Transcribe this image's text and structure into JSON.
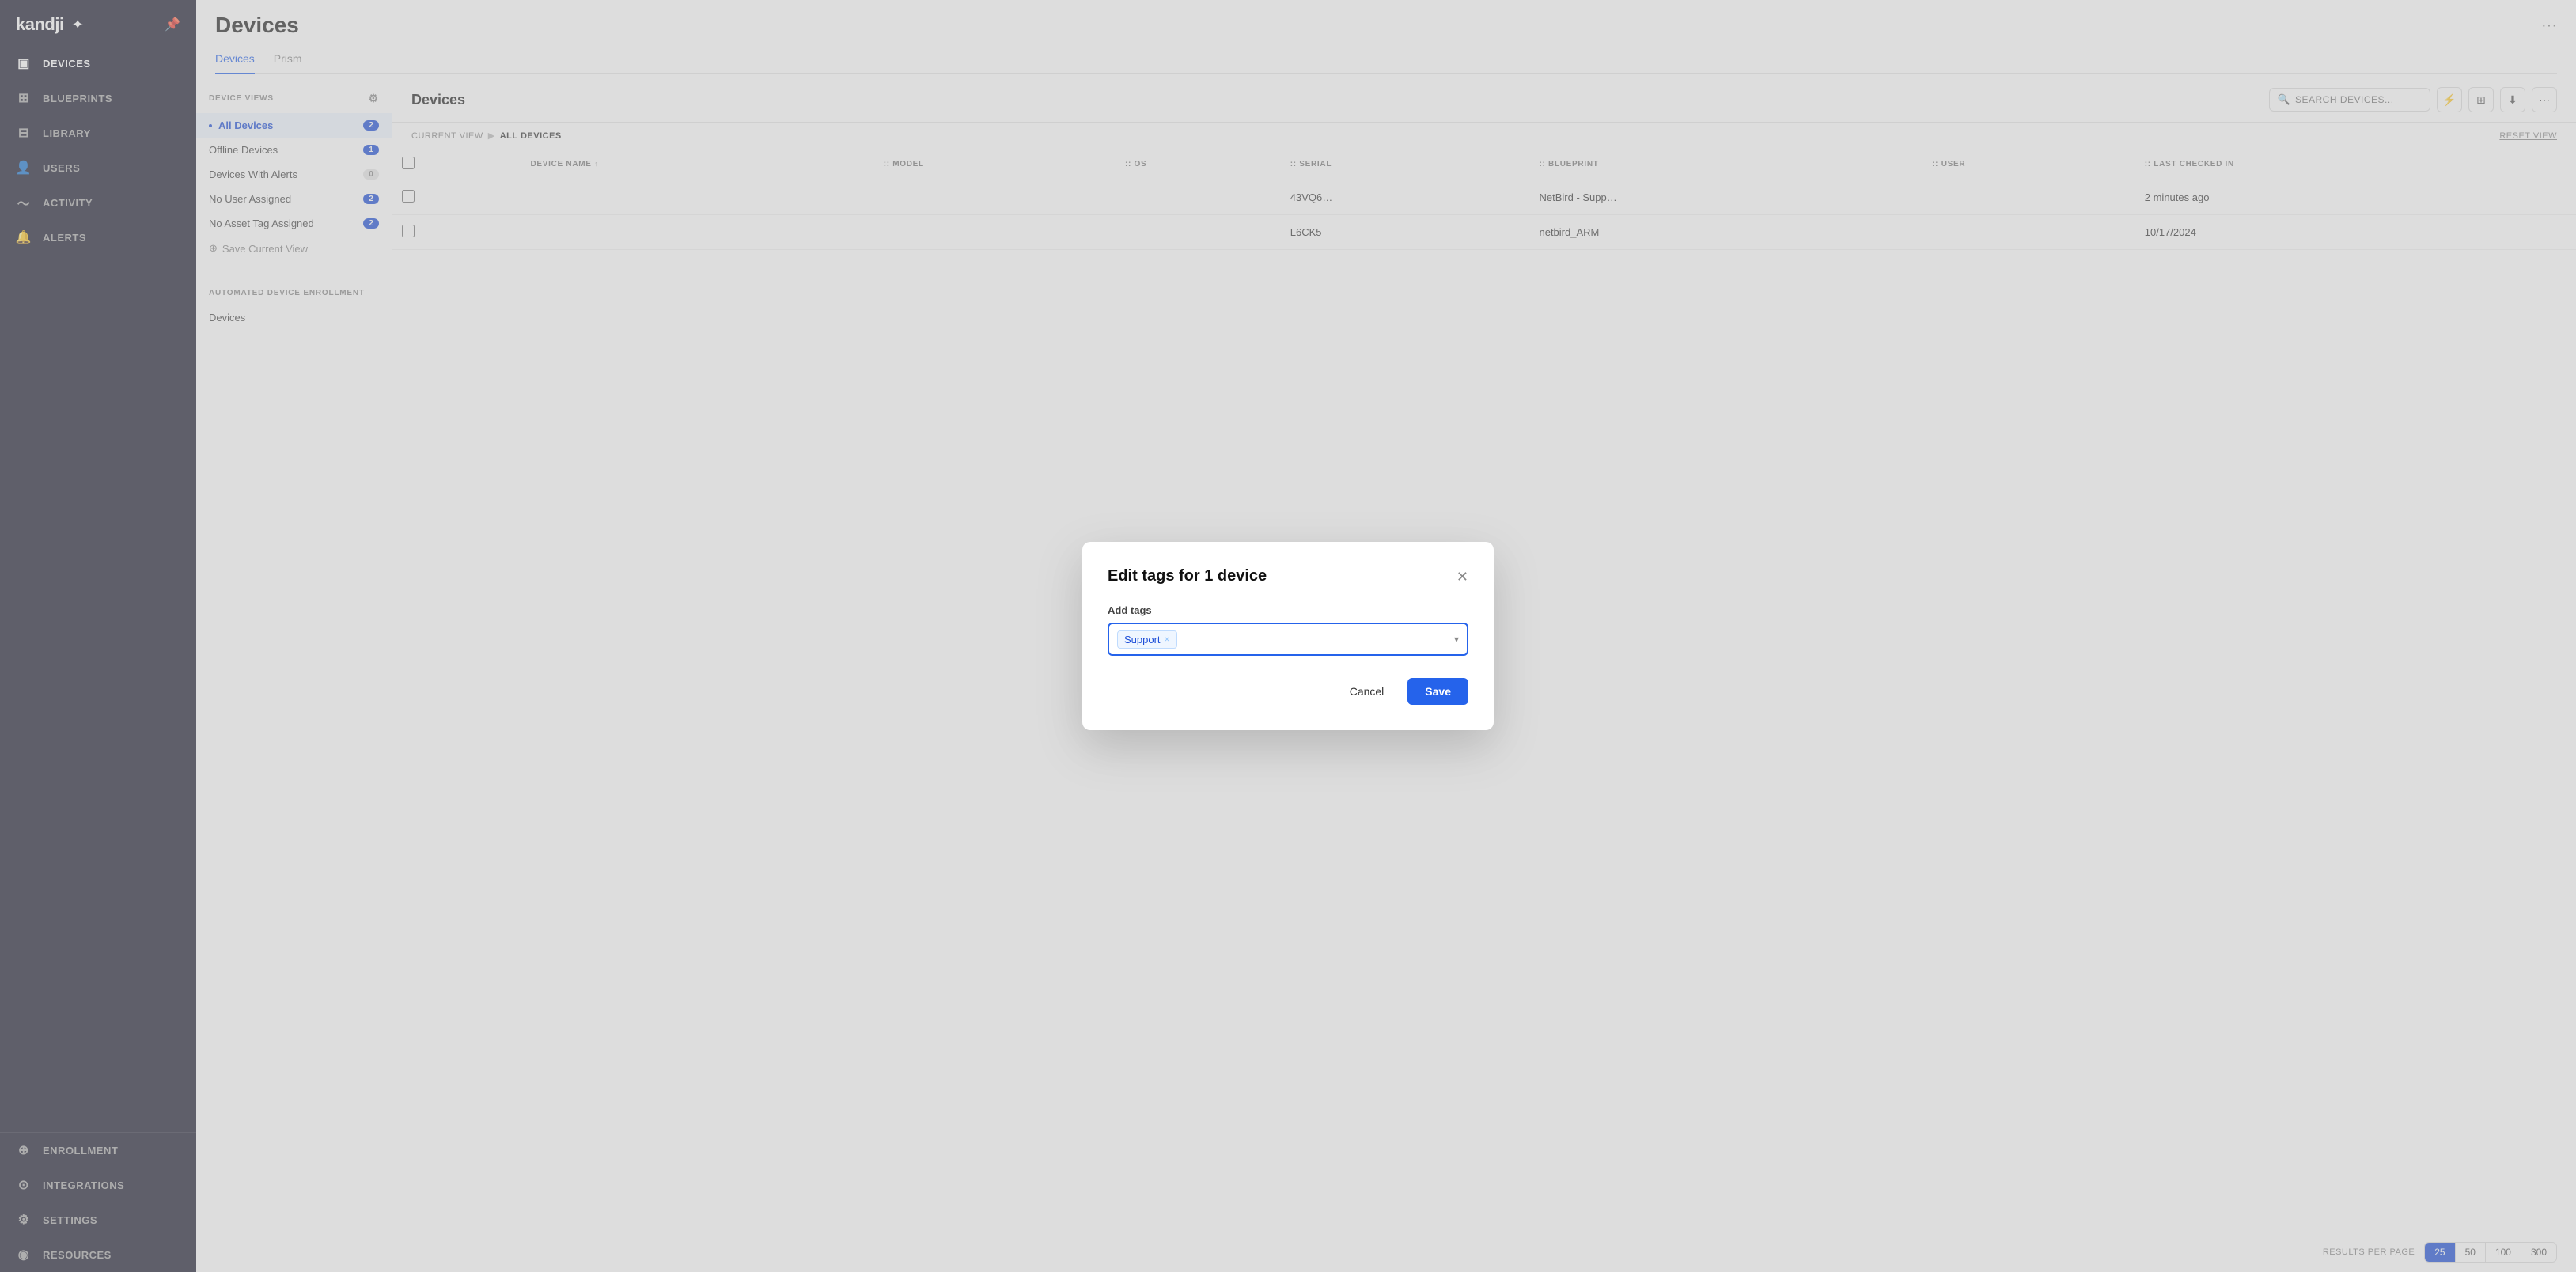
{
  "sidebar": {
    "logo": "kandji",
    "logo_bird": "✦",
    "pin_icon": "📌",
    "nav_items": [
      {
        "id": "devices",
        "label": "DEVICES",
        "icon": "▣",
        "active": true
      },
      {
        "id": "blueprints",
        "label": "BLUEPRINTS",
        "icon": "⊞"
      },
      {
        "id": "library",
        "label": "LIBRARY",
        "icon": "⊟"
      },
      {
        "id": "users",
        "label": "USERS",
        "icon": "👤"
      },
      {
        "id": "activity",
        "label": "ACTIVITY",
        "icon": "〜"
      },
      {
        "id": "alerts",
        "label": "ALERTS",
        "icon": "🔔"
      }
    ],
    "bottom_items": [
      {
        "id": "enrollment",
        "label": "ENROLLMENT",
        "icon": "⊕"
      },
      {
        "id": "integrations",
        "label": "INTEGRATIONS",
        "icon": "⊙"
      },
      {
        "id": "settings",
        "label": "SETTINGS",
        "icon": "⚙"
      },
      {
        "id": "resources",
        "label": "RESOURCES",
        "icon": "◉"
      }
    ]
  },
  "page": {
    "title": "Devices",
    "tabs": [
      {
        "id": "devices",
        "label": "Devices",
        "active": true
      },
      {
        "id": "prism",
        "label": "Prism"
      }
    ]
  },
  "device_views": {
    "section_label": "DEVICE VIEWS",
    "items": [
      {
        "id": "all_devices",
        "label": "All Devices",
        "count": "2",
        "active": true
      },
      {
        "id": "offline_devices",
        "label": "Offline Devices",
        "count": "1"
      },
      {
        "id": "devices_with_alerts",
        "label": "Devices With Alerts",
        "count": "0",
        "zero": true
      },
      {
        "id": "no_user_assigned",
        "label": "No User Assigned",
        "count": "2"
      },
      {
        "id": "no_asset_tag",
        "label": "No Asset Tag Assigned",
        "count": "2"
      }
    ],
    "save_view_btn": "Save Current View",
    "enrollment_section_label": "AUTOMATED DEVICE ENROLLMENT",
    "enrollment_items": [
      {
        "id": "devices_enroll",
        "label": "Devices"
      }
    ]
  },
  "devices_panel": {
    "title": "Devices",
    "search_placeholder": "SEARCH DEVICES...",
    "toolbar_more": "···",
    "breadcrumb_current_view": "CURRENT VIEW",
    "breadcrumb_arrow": "▶",
    "breadcrumb_all_devices": "ALL DEVICES",
    "reset_view": "RESET VIEW",
    "table": {
      "columns": [
        {
          "id": "check",
          "label": ""
        },
        {
          "id": "device_name",
          "label": "DEVICE NAME"
        },
        {
          "id": "model",
          "label": "MODEL"
        },
        {
          "id": "os",
          "label": "OS"
        },
        {
          "id": "serial",
          "label": "SERIAL"
        },
        {
          "id": "blueprint",
          "label": "BLUEPRINT"
        },
        {
          "id": "user",
          "label": "USER"
        },
        {
          "id": "last_checked",
          "label": "LAST CHECKED IN"
        }
      ],
      "rows": [
        {
          "device_name": "",
          "model": "",
          "os": "",
          "serial": "43VQ6…",
          "blueprint": "NetBird - Supp…",
          "user": "",
          "last_checked": "2 minutes ago"
        },
        {
          "device_name": "",
          "model": "",
          "os": "",
          "serial": "L6CK5",
          "blueprint": "netbird_ARM",
          "user": "",
          "last_checked": "10/17/2024"
        }
      ]
    },
    "pagination": {
      "label": "RESULTS PER PAGE",
      "options": [
        "25",
        "50",
        "100",
        "300"
      ],
      "active": "25"
    }
  },
  "modal": {
    "title": "Edit tags for 1 device",
    "add_tags_label": "Add tags",
    "tag_chip_label": "Support",
    "tag_chip_remove": "×",
    "dropdown_arrow": "▾",
    "cancel_label": "Cancel",
    "save_label": "Save"
  }
}
